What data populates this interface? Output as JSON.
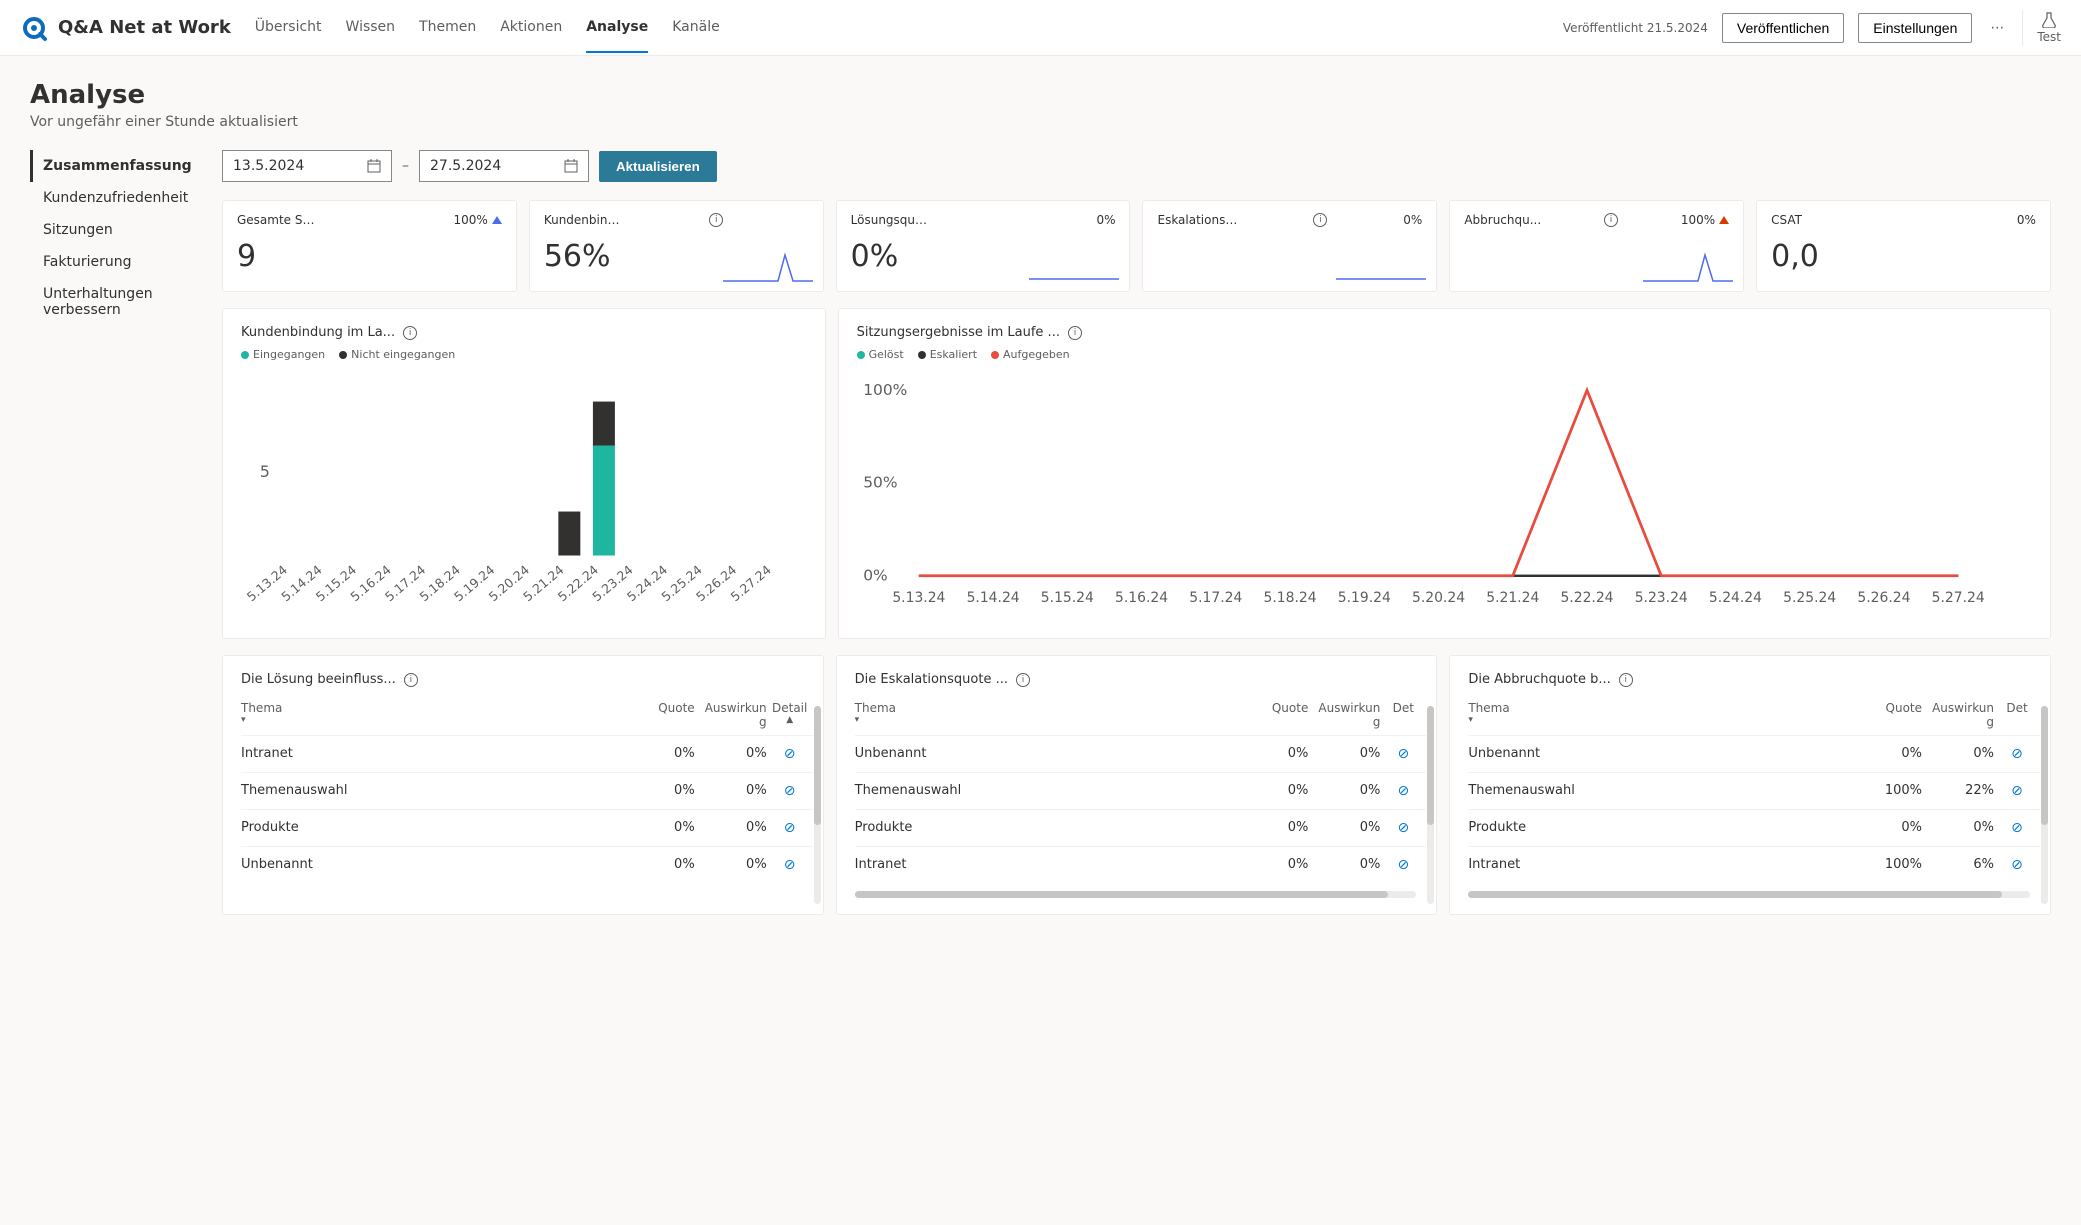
{
  "header": {
    "app_name": "Q&A Net at Work",
    "nav": [
      "Übersicht",
      "Wissen",
      "Themen",
      "Aktionen",
      "Analyse",
      "Kanäle"
    ],
    "active_nav": 4,
    "published_text": "Veröffentlicht 21.5.2024",
    "publish_btn": "Veröffentlichen",
    "settings_btn": "Einstellungen",
    "test_label": "Test"
  },
  "page": {
    "title": "Analyse",
    "subtitle": "Vor ungefähr einer Stunde aktualisiert"
  },
  "sidenav": {
    "items": [
      "Zusammenfassung",
      "Kundenzufriedenheit",
      "Sitzungen",
      "Fakturierung",
      "Unterhaltungen verbessern"
    ],
    "active": 0
  },
  "filter": {
    "date_from": "13.5.2024",
    "date_to": "27.5.2024",
    "update_btn": "Aktualisieren"
  },
  "kpis": [
    {
      "title": "Gesamte Sitz...",
      "pct": "100%",
      "trend": "up-blue",
      "big": "9",
      "spark": "flat",
      "info": false
    },
    {
      "title": "Kundenbindung...",
      "pct": "",
      "trend": "",
      "big": "56%",
      "spark": "spike",
      "info": true
    },
    {
      "title": "Lösungsquote",
      "pct": "0%",
      "trend": "",
      "big": "0%",
      "spark": "line",
      "info": false
    },
    {
      "title": "Eskalationsq...",
      "pct": "0%",
      "trend": "",
      "big": "",
      "spark": "line",
      "info": true
    },
    {
      "title": "Abbruchqu...",
      "pct": "100%",
      "trend": "up-orange",
      "big": "",
      "spark": "spike",
      "info": true
    },
    {
      "title": "CSAT",
      "pct": "0%",
      "trend": "",
      "big": "0,0",
      "spark": "",
      "info": false
    }
  ],
  "charts": {
    "engagement": {
      "title": "Kundenbindung im La...",
      "legend": [
        {
          "label": "Eingegangen",
          "color": "#1fb6a0"
        },
        {
          "label": "Nicht eingegangen",
          "color": "#323130"
        }
      ],
      "y_tick": "5"
    },
    "outcomes": {
      "title": "Sitzungsergebnisse im Laufe ...",
      "legend": [
        {
          "label": "Gelöst",
          "color": "#1fb6a0"
        },
        {
          "label": "Eskaliert",
          "color": "#323130"
        },
        {
          "label": "Aufgegeben",
          "color": "#e74c3c"
        }
      ],
      "y_ticks": [
        "100%",
        "50%",
        "0%"
      ]
    },
    "x_dates": [
      "5.13.24",
      "5.14.24",
      "5.15.24",
      "5.16.24",
      "5.17.24",
      "5.18.24",
      "5.19.24",
      "5.20.24",
      "5.21.24",
      "5.22.24",
      "5.23.24",
      "5.24.24",
      "5.25.24",
      "5.26.24",
      "5.27.24"
    ]
  },
  "tables": {
    "headers": {
      "thema": "Thema",
      "quote": "Quote",
      "auswirkung": "Auswirkun\ng",
      "detail": "Detail",
      "det": "Det"
    },
    "resolution": {
      "title": "Die Lösung beeinfluss...",
      "rows": [
        {
          "thema": "Intranet",
          "quote": "0%",
          "auswirkung": "0%"
        },
        {
          "thema": "Themenauswahl",
          "quote": "0%",
          "auswirkung": "0%"
        },
        {
          "thema": "Produkte",
          "quote": "0%",
          "auswirkung": "0%"
        },
        {
          "thema": "Unbenannt",
          "quote": "0%",
          "auswirkung": "0%"
        }
      ]
    },
    "escalation": {
      "title": "Die Eskalationsquote ...",
      "rows": [
        {
          "thema": "Unbenannt",
          "quote": "0%",
          "auswirkung": "0%"
        },
        {
          "thema": "Themenauswahl",
          "quote": "0%",
          "auswirkung": "0%"
        },
        {
          "thema": "Produkte",
          "quote": "0%",
          "auswirkung": "0%"
        },
        {
          "thema": "Intranet",
          "quote": "0%",
          "auswirkung": "0%"
        }
      ]
    },
    "abandon": {
      "title": "Die Abbruchquote b...",
      "rows": [
        {
          "thema": "Unbenannt",
          "quote": "0%",
          "auswirkung": "0%"
        },
        {
          "thema": "Themenauswahl",
          "quote": "100%",
          "auswirkung": "22%"
        },
        {
          "thema": "Produkte",
          "quote": "0%",
          "auswirkung": "0%"
        },
        {
          "thema": "Intranet",
          "quote": "100%",
          "auswirkung": "6%"
        }
      ]
    }
  },
  "chart_data": [
    {
      "type": "bar",
      "title": "Kundenbindung im Laufe der Zeit",
      "categories": [
        "5.13.24",
        "5.14.24",
        "5.15.24",
        "5.16.24",
        "5.17.24",
        "5.18.24",
        "5.19.24",
        "5.20.24",
        "5.21.24",
        "5.22.24",
        "5.23.24",
        "5.24.24",
        "5.25.24",
        "5.26.24",
        "5.27.24"
      ],
      "series": [
        {
          "name": "Eingegangen",
          "values": [
            0,
            0,
            0,
            0,
            0,
            0,
            0,
            0,
            0,
            5,
            0,
            0,
            0,
            0,
            0
          ]
        },
        {
          "name": "Nicht eingegangen",
          "values": [
            0,
            0,
            0,
            0,
            0,
            0,
            0,
            0,
            2,
            2,
            0,
            0,
            0,
            0,
            0
          ]
        }
      ],
      "ylim": [
        0,
        7
      ]
    },
    {
      "type": "line",
      "title": "Sitzungsergebnisse im Laufe der Zeit",
      "x": [
        "5.13.24",
        "5.14.24",
        "5.15.24",
        "5.16.24",
        "5.17.24",
        "5.18.24",
        "5.19.24",
        "5.20.24",
        "5.21.24",
        "5.22.24",
        "5.23.24",
        "5.24.24",
        "5.25.24",
        "5.26.24",
        "5.27.24"
      ],
      "series": [
        {
          "name": "Gelöst",
          "values": [
            0,
            0,
            0,
            0,
            0,
            0,
            0,
            0,
            0,
            0,
            0,
            0,
            0,
            0,
            0
          ]
        },
        {
          "name": "Eskaliert",
          "values": [
            0,
            0,
            0,
            0,
            0,
            0,
            0,
            0,
            0,
            0,
            0,
            0,
            0,
            0,
            0
          ]
        },
        {
          "name": "Aufgegeben",
          "values": [
            0,
            0,
            0,
            0,
            0,
            0,
            0,
            0,
            0,
            100,
            0,
            0,
            0,
            0,
            0
          ]
        }
      ],
      "ylabel": "%",
      "ylim": [
        0,
        100
      ]
    }
  ]
}
